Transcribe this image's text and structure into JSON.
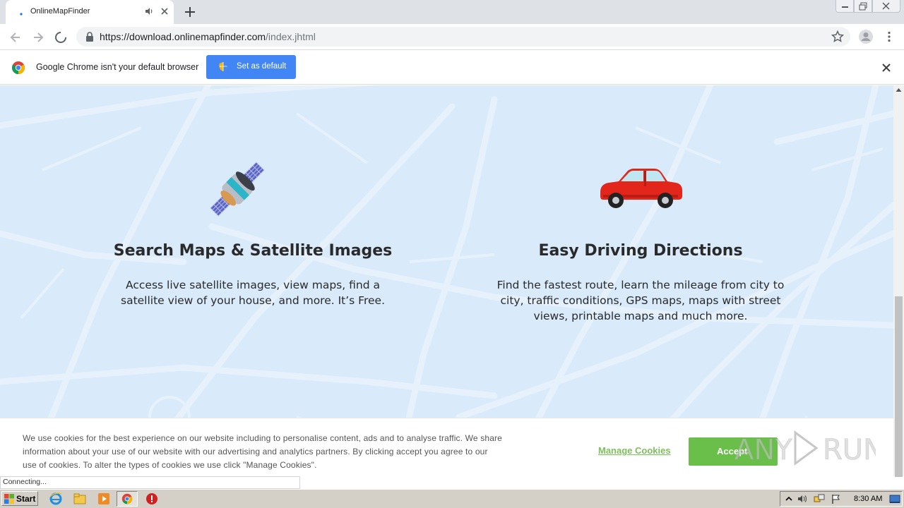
{
  "browser": {
    "tab": {
      "title": "OnlineMapFinder"
    },
    "url": {
      "host": "https://download.onlinemapfinder.com",
      "path": "/index.jhtml"
    }
  },
  "infobar": {
    "message": "Google Chrome isn't your default browser",
    "set_default_label": "Set as default"
  },
  "features": [
    {
      "icon": "satellite-icon",
      "title": "Search Maps & Satellite Images",
      "description": "Access live satellite images, view maps, find a satellite view of your house, and more. It’s Free."
    },
    {
      "icon": "car-icon",
      "title": "Easy Driving Directions",
      "description": "Find the fastest route, learn the mileage from city to city, traffic conditions, GPS maps, maps with street views, printable maps and much more."
    }
  ],
  "cookie_banner": {
    "text": "We use cookies for the best experience on our website including to personalise content, ads and to analyse traffic. We share information about your use of our website with our advertising and analytics partners. By clicking accept you agree to our use of cookies. To alter the types of cookies we use click \"Manage Cookies\".",
    "manage_label": "Manage Cookies",
    "accept_label": "Accept"
  },
  "status_bar": {
    "text": "Connecting..."
  },
  "taskbar": {
    "start_label": "Start",
    "clock": "8:30 AM"
  },
  "watermark": {
    "text": "ANY RUN"
  },
  "colors": {
    "page_bg": "#d9eafb",
    "set_default_button": "#4285f4",
    "accept_button": "#6abf4b",
    "manage_link": "#7cbf5b"
  }
}
